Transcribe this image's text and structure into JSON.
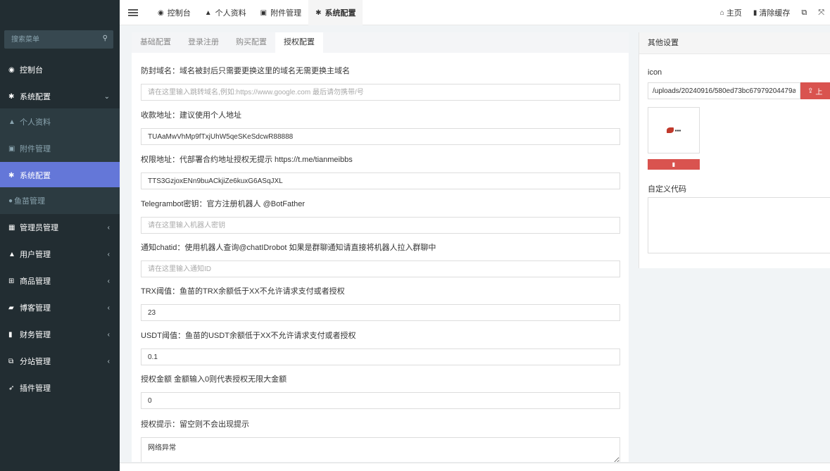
{
  "topbar": {
    "tabs": [
      {
        "label": "控制台",
        "icon": "dashboard-icon"
      },
      {
        "label": "个人资料",
        "icon": "user-icon"
      },
      {
        "label": "附件管理",
        "icon": "image-icon"
      },
      {
        "label": "系统配置",
        "icon": "gear-icon"
      }
    ],
    "home_label": "主页",
    "clear_cache_label": "清除缓存"
  },
  "sidebar": {
    "search_placeholder": "搜索菜单",
    "items": [
      {
        "label": "控制台"
      },
      {
        "label": "系统配置"
      },
      {
        "label": "个人资料"
      },
      {
        "label": "附件管理"
      },
      {
        "label": "系统配置"
      },
      {
        "label": "鱼苗管理"
      },
      {
        "label": "管理员管理"
      },
      {
        "label": "用户管理"
      },
      {
        "label": "商品管理"
      },
      {
        "label": "博客管理"
      },
      {
        "label": "财务管理"
      },
      {
        "label": "分站管理"
      },
      {
        "label": "插件管理"
      }
    ]
  },
  "config_tabs": [
    "基础配置",
    "登录注册",
    "购买配置",
    "授权配置"
  ],
  "form": {
    "fields": [
      {
        "label": "防封域名：域名被封后只需要更换这里的域名无需更换主域名",
        "value": "",
        "placeholder": "请在这里输入跳转域名,例如:https://www.google.com 最后请勿携带/号"
      },
      {
        "label": "收款地址：建议使用个人地址",
        "value": "TUAaMwVhMp9fTxjUhW5qeSKeSdcwR88888",
        "placeholder": ""
      },
      {
        "label": "权限地址：代部署合约地址授权无提示 https://t.me/tianmeibbs",
        "value": "TTS3GzjoxENn9buACkjiZe6kuxG6ASqJXL",
        "placeholder": ""
      },
      {
        "label": "Telegrambot密钥：官方注册机器人 @BotFather",
        "value": "",
        "placeholder": "请在这里输入机器人密钥"
      },
      {
        "label": "通知chatid：使用机器人查询@chatIDrobot 如果是群聊通知请直接将机器人拉入群聊中",
        "value": "",
        "placeholder": "请在这里输入通知ID"
      },
      {
        "label": "TRX阈值：鱼苗的TRX余额低于XX不允许请求支付或者授权",
        "value": "23",
        "placeholder": ""
      },
      {
        "label": "USDT阈值：鱼苗的USDT余额低于XX不允许请求支付或者授权",
        "value": "0.1",
        "placeholder": ""
      },
      {
        "label": "授权金额 金额输入0则代表授权无限大金额",
        "value": "0",
        "placeholder": ""
      },
      {
        "label": "授权提示：留空则不会出现提示",
        "value": "网络异常",
        "placeholder": ""
      }
    ]
  },
  "other_settings": {
    "title": "其他设置",
    "icon_label": "icon",
    "icon_value": "/uploads/20240916/580ed73bc67979204479a",
    "upload_label": "上",
    "custom_code_label": "自定义代码"
  },
  "colors": {
    "sidebar_bg": "#222d32",
    "active_nav": "#6477d8",
    "danger": "#d9534f"
  }
}
